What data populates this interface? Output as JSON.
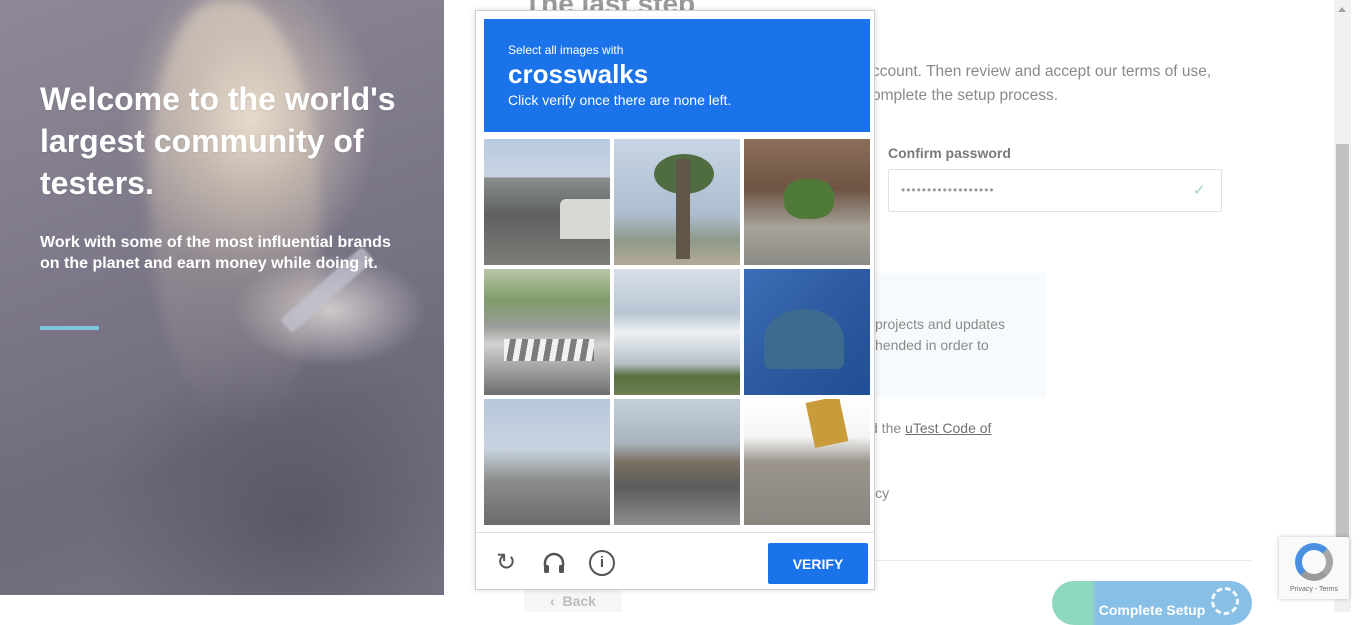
{
  "hero": {
    "title": "Welcome to the world's largest community of testers.",
    "subtitle": "Work with some of the most influential brands on the planet and earn money while doing it."
  },
  "form": {
    "step_title": "The last step",
    "intro_line1": "ccount. Then review and accept our terms of use,",
    "intro_line2": "omplete the setup process.",
    "confirm_password_label": "Confirm password",
    "confirm_password_value": "••••••••••••••••••",
    "pref_line1": "projects and updates",
    "pref_line2": "hended in order to",
    "code_prefix": "d the ",
    "code_link": "uTest Code of",
    "policy_text": "icy",
    "back_label": "Back",
    "complete_label": "Complete Setup"
  },
  "captcha": {
    "prompt": "Select all images with",
    "keyword": "crosswalks",
    "instruction": "Click verify once there are none left.",
    "verify_label": "VERIFY",
    "tiles": [
      "tile-1",
      "tile-2",
      "tile-3",
      "tile-4",
      "tile-5",
      "tile-6",
      "tile-7",
      "tile-8",
      "tile-9"
    ]
  },
  "recaptcha_badge": {
    "terms": "Privacy - Terms"
  },
  "icons": {
    "back": "chevron-left-icon",
    "check": "check-icon",
    "reload": "reload-icon",
    "audio": "headphones-icon",
    "info": "info-icon"
  },
  "colors": {
    "captcha_blue": "#1a73e8",
    "accent_line": "#7fc4d8",
    "complete_green": "#8fd8c0",
    "complete_blue": "#88bfe6"
  }
}
